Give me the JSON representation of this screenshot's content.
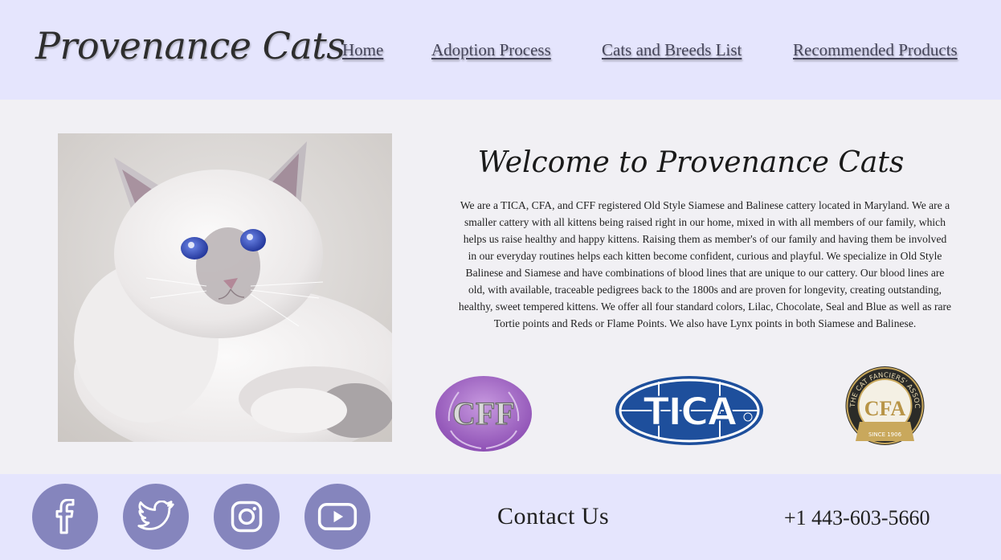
{
  "header": {
    "logo": "Provenance Cats",
    "nav": [
      "Home",
      "Adoption Process",
      "Cats and Breeds List",
      "Recommended Products"
    ]
  },
  "main": {
    "welcome_title": "Welcome to Provenance Cats",
    "intro": "We are a TICA, CFA, and CFF registered Old Style Siamese and Balinese cattery located in Maryland. We are a smaller cattery with all kittens being raised right in our home, mixed in with all members of our family, which helps us raise healthy and happy kittens. Raising them as member's of our family and having them be involved in our everyday routines helps each kitten become confident, curious and playful. We specialize in Old Style Balinese and Siamese and have combinations of blood lines that are unique to our cattery. Our blood lines are old, with available, traceable pedigrees back to the 1800s and are proven for longevity, creating outstanding, healthy, sweet tempered kittens. We offer all four standard colors, Lilac, Chocolate, Seal and Blue as well as rare Tortie points and Reds or Flame Points. We also have Lynx points in both Siamese and Balinese.",
    "badges": {
      "cff": "CFF",
      "tica": "TICA",
      "cfa_ring": "THE CAT FANCIERS' ASSOCIATION",
      "cfa_monogram": "CFA",
      "cfa_since": "SINCE 1906"
    }
  },
  "footer": {
    "social_icons": [
      "facebook-icon",
      "twitter-icon",
      "instagram-icon",
      "youtube-icon"
    ],
    "contact_label": "Contact Us",
    "phone": "+1 443-603-5660"
  },
  "colors": {
    "header_bg": "#e5e5fd",
    "page_bg": "#f1f0f4",
    "social_bg": "#8585bd",
    "cff_purple": "#a872c8",
    "tica_blue": "#1e4f9c",
    "cfa_dark": "#2b2b28",
    "cfa_gold": "#c9a85c"
  }
}
